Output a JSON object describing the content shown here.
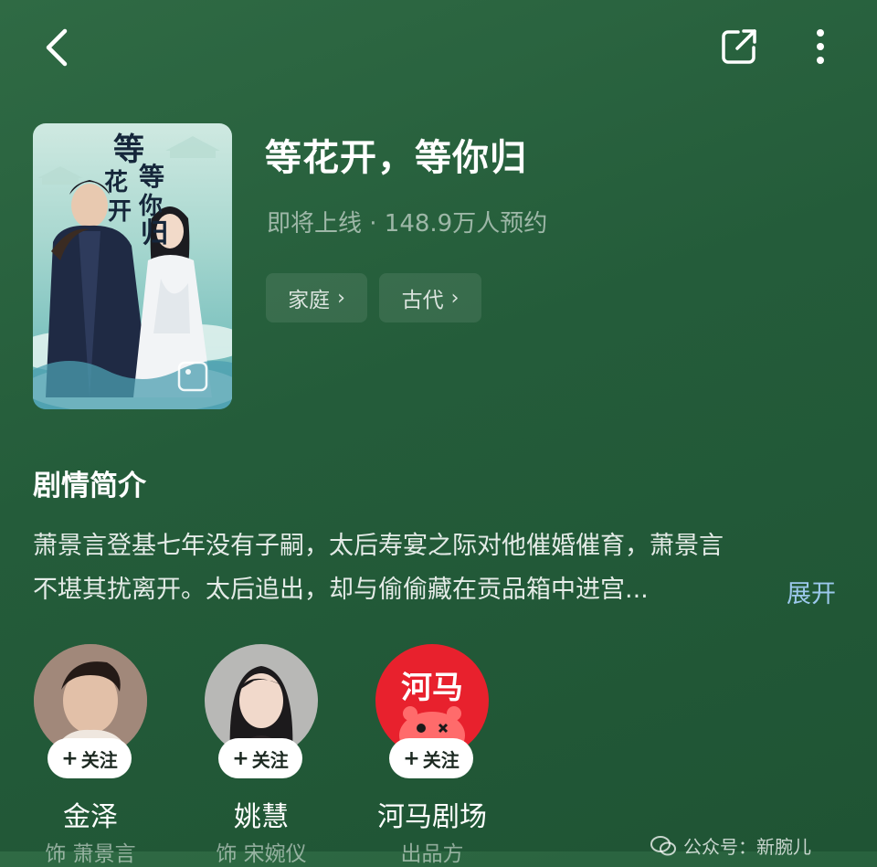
{
  "header": {
    "back_icon": "chevron-left-icon",
    "share_icon": "share-external-icon",
    "more_icon": "more-vertical-icon"
  },
  "show": {
    "title": "等花开，等你归",
    "status_line": "即将上线 · 148.9万人预约",
    "poster_title_text": "等花开 等你归",
    "tags": [
      {
        "label": "家庭"
      },
      {
        "label": "古代"
      }
    ]
  },
  "synopsis": {
    "heading": "剧情简介",
    "line1": "萧景言登基七年没有子嗣，太后寿宴之际对他催婚催育，萧景言",
    "line2": "不堪其扰离开。太后追出，却与偷偷藏在贡品箱中进宫...",
    "expand_label": "展开"
  },
  "cast": [
    {
      "name": "金泽",
      "role": "饰 萧景言",
      "follow_label": "关注"
    },
    {
      "name": "姚慧",
      "role": "饰 宋婉仪",
      "follow_label": "关注"
    },
    {
      "name": "河马剧场",
      "role": "出品方",
      "follow_label": "关注",
      "logo_text": "河马"
    }
  ],
  "watermark": {
    "text": "公众号：新腕儿"
  },
  "colors": {
    "background": "#245c3a",
    "expand_link": "#9cc8ec",
    "hema_red": "#e8212d"
  }
}
